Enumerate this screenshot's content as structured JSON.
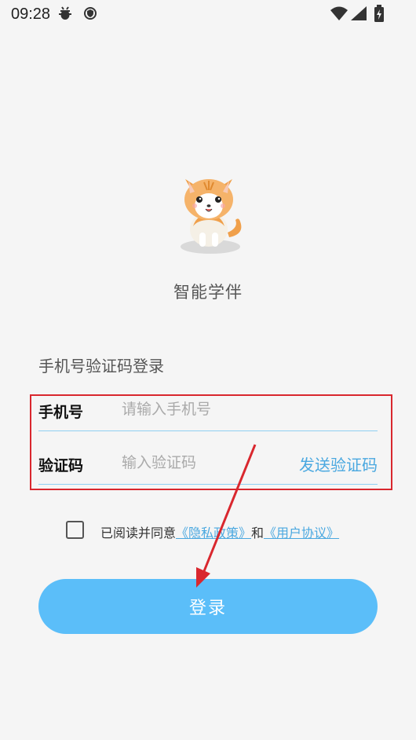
{
  "status_bar": {
    "time": "09:28"
  },
  "app": {
    "name": "智能学伴"
  },
  "login": {
    "title": "手机号验证码登录",
    "phone_label": "手机号",
    "phone_placeholder": "请输入手机号",
    "code_label": "验证码",
    "code_placeholder": "输入验证码",
    "send_code": "发送验证码",
    "agree_prefix": "已阅读并同意",
    "privacy_link": "《隐私政策》",
    "and": "和",
    "terms_link": "《用户协议》",
    "button": "登录"
  },
  "colors": {
    "accent": "#5bbef9",
    "link": "#4aa8e0",
    "highlight_border": "#d9272e",
    "arrow": "#d9272e"
  },
  "icons": [
    "bug-icon",
    "shield-icon",
    "wifi-icon",
    "signal-icon",
    "battery-icon",
    "cat-mascot"
  ]
}
